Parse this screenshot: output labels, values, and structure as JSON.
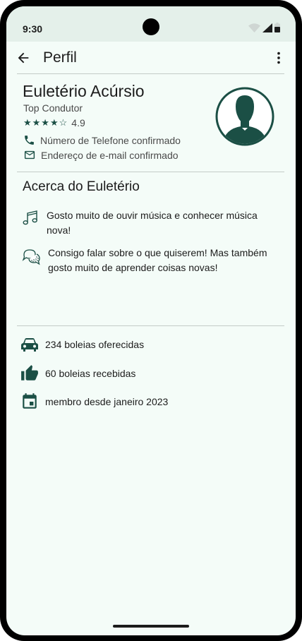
{
  "status_bar": {
    "time": "9:30"
  },
  "app_bar": {
    "title": "Perfil",
    "back_icon": "arrow-left-icon",
    "menu_icon": "more-vert-icon"
  },
  "profile": {
    "name": "Euletério Acúrsio",
    "subtitle": "Top Condutor",
    "stars_display": "★★★★☆",
    "stars_filled": 4,
    "stars_total": 5,
    "rating": "4.9",
    "phone_verified": "Número de Telefone confirmado",
    "email_verified": "Endereço de e-mail confirmado"
  },
  "about": {
    "title": "Acerca do Euletério",
    "items": [
      {
        "icon": "music-note-icon",
        "text": "Gosto muito de ouvir música e conhecer música nova!"
      },
      {
        "icon": "chat-bubbles-icon",
        "text": "Consigo falar sobre o que quiserem! Mas também gosto muito de aprender coisas novas!"
      }
    ]
  },
  "stats": [
    {
      "icon": "car-icon",
      "text": "234 boleias oferecidas"
    },
    {
      "icon": "thumb-up-icon",
      "text": "60 boleias recebidas"
    },
    {
      "icon": "calendar-icon",
      "text": "membro desde janeiro 2023"
    }
  ],
  "colors": {
    "accent": "#1b4f45",
    "background": "#f4fcf8",
    "status_bar": "#e4f0ea"
  }
}
